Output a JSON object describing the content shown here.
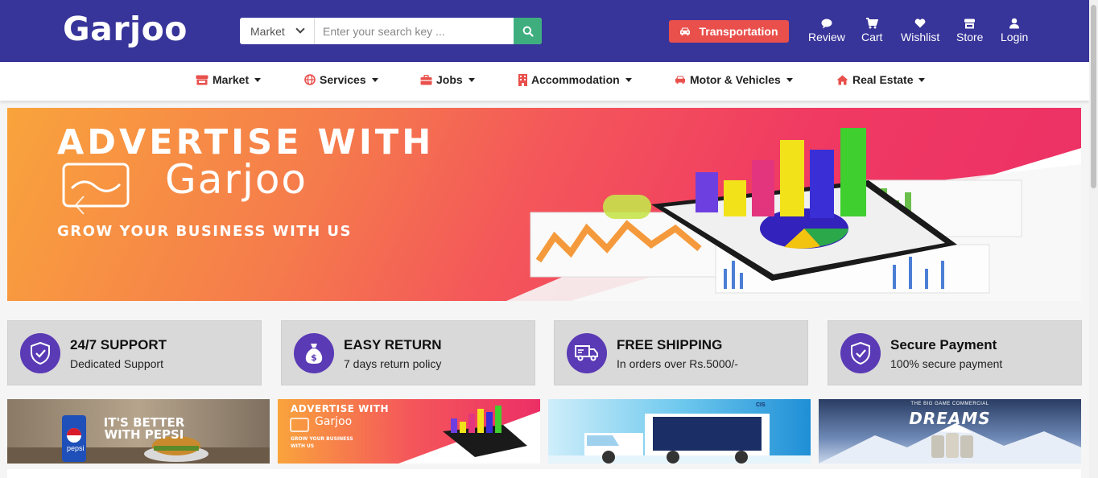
{
  "header": {
    "logo": "Garjoo",
    "search": {
      "category": "Market",
      "placeholder": "Enter your search key ..."
    },
    "transport_label": "Transportation",
    "nav": [
      {
        "label": "Review",
        "icon": "comment-icon"
      },
      {
        "label": "Cart",
        "icon": "cart-icon"
      },
      {
        "label": "Wishlist",
        "icon": "heart-icon"
      },
      {
        "label": "Store",
        "icon": "store-icon"
      },
      {
        "label": "Login",
        "icon": "user-icon"
      }
    ]
  },
  "categories": [
    {
      "label": "Market",
      "icon": "store-icon"
    },
    {
      "label": "Services",
      "icon": "globe-icon"
    },
    {
      "label": "Jobs",
      "icon": "briefcase-icon"
    },
    {
      "label": "Accommodation",
      "icon": "building-icon"
    },
    {
      "label": "Motor & Vehicles",
      "icon": "car-icon"
    },
    {
      "label": "Real Estate",
      "icon": "home-icon"
    }
  ],
  "hero": {
    "title": "ADVERTISE WITH",
    "brand": "Garjoo",
    "tagline": "GROW YOUR BUSINESS WITH US"
  },
  "features": [
    {
      "title": "24/7 SUPPORT",
      "subtitle": "Dedicated Support",
      "icon": "shield-check-icon"
    },
    {
      "title": "EASY RETURN",
      "subtitle": "7 days return policy",
      "icon": "money-bag-icon"
    },
    {
      "title": "FREE SHIPPING",
      "subtitle": "In orders over Rs.5000/-",
      "icon": "truck-icon"
    },
    {
      "title": "Secure Payment",
      "subtitle": "100% secure payment",
      "icon": "shield-check-icon"
    }
  ],
  "promos": [
    {
      "text": "IT'S BETTER WITH PEPSI",
      "brand": "pepsi"
    },
    {
      "title": "ADVERTISE WITH",
      "brand": "Garjoo",
      "tagline": "GROW YOUR BUSINESS WITH US"
    },
    {
      "brand": "CIS"
    },
    {
      "kicker": "THE BIG GAME COMMERCIAL",
      "text": "DREAMS"
    }
  ],
  "colors": {
    "header": "#37349a",
    "accent_red": "#e9504c",
    "search_green": "#3fae7f",
    "feature_icon": "#5a3ab5"
  }
}
